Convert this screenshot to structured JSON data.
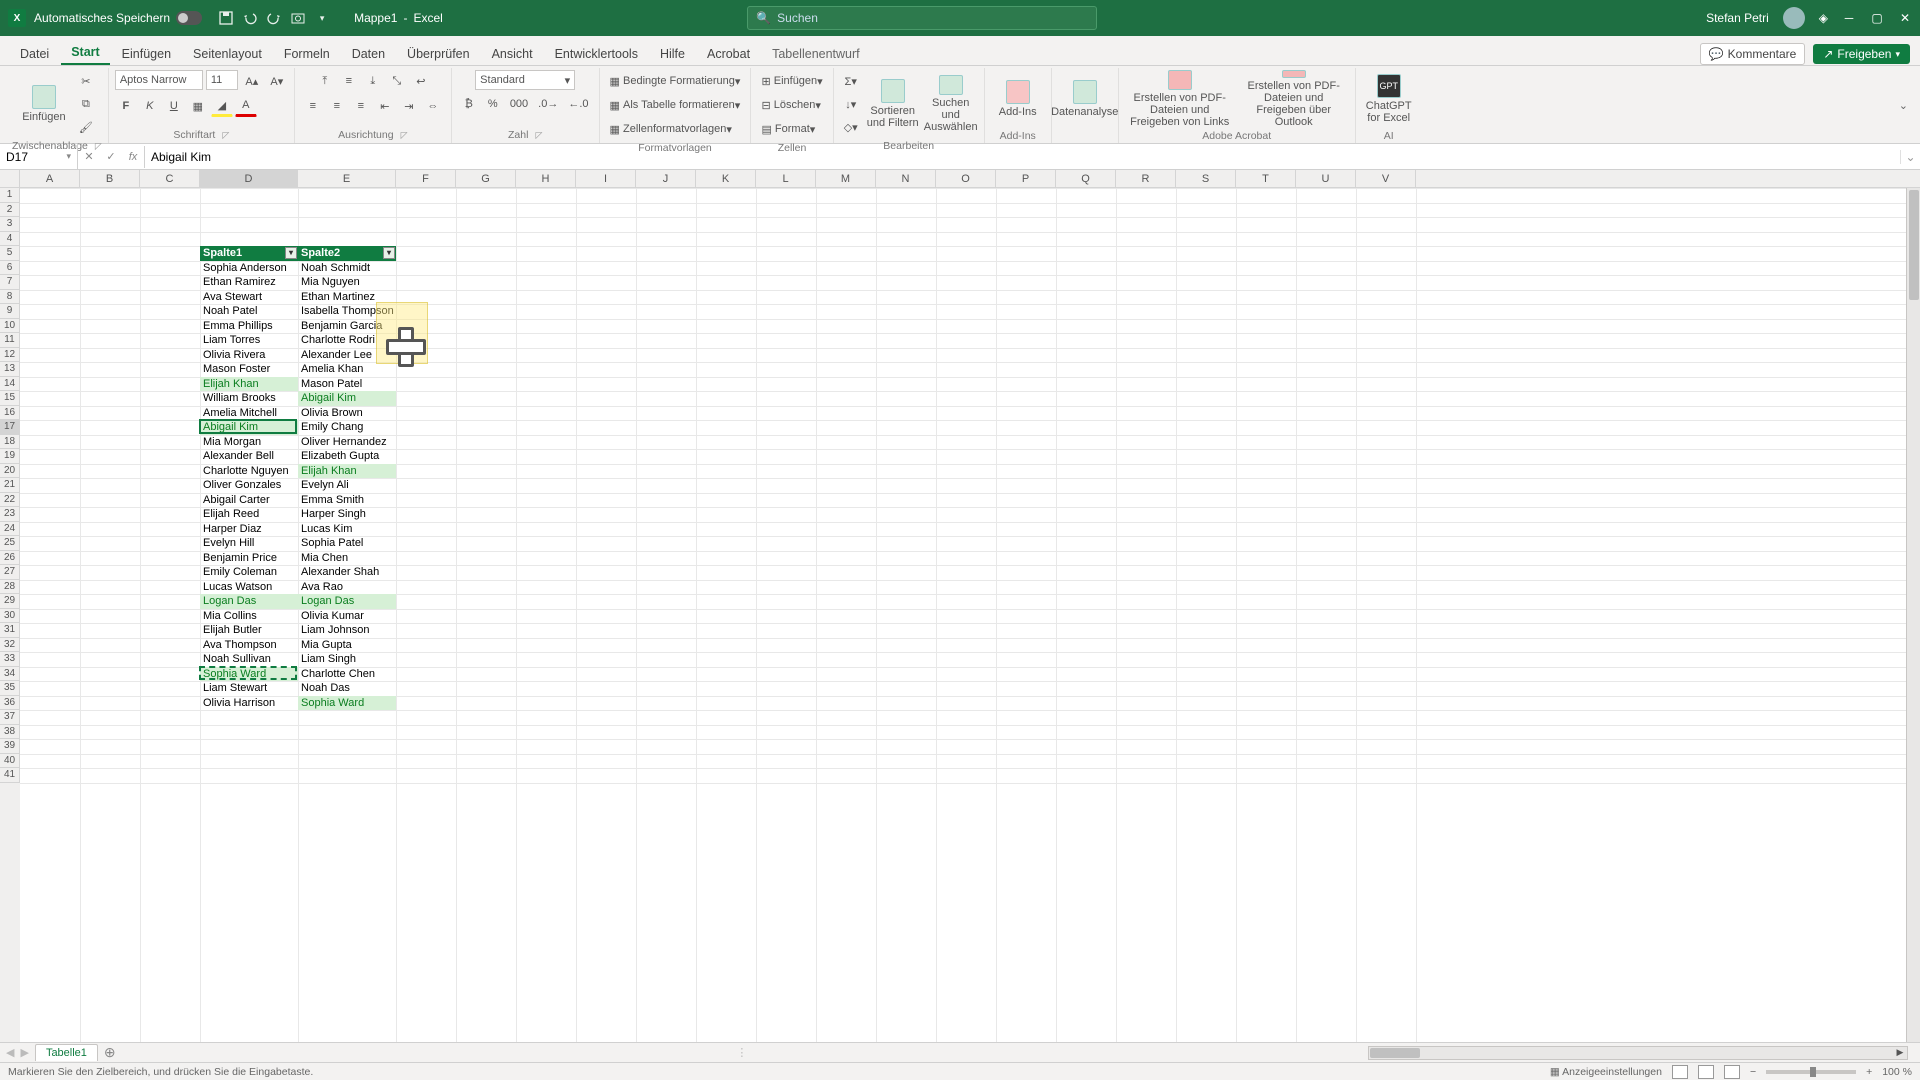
{
  "title": {
    "autosave": "Automatisches Speichern",
    "doc": "Mappe1",
    "app": "Excel",
    "search_placeholder": "Suchen",
    "user": "Stefan Petri"
  },
  "tabs": {
    "file": "Datei",
    "home": "Start",
    "insert": "Einfügen",
    "layout": "Seitenlayout",
    "formulas": "Formeln",
    "data": "Daten",
    "review": "Überprüfen",
    "view": "Ansicht",
    "dev": "Entwicklertools",
    "help": "Hilfe",
    "acrobat": "Acrobat",
    "tabledesign": "Tabellenentwurf",
    "comments": "Kommentare",
    "share": "Freigeben"
  },
  "ribbon": {
    "clipboard": {
      "paste": "Einfügen",
      "label": "Zwischenablage"
    },
    "font": {
      "name": "Aptos Narrow",
      "size": "11",
      "label": "Schriftart"
    },
    "align": {
      "label": "Ausrichtung"
    },
    "number": {
      "format": "Standard",
      "label": "Zahl"
    },
    "styles": {
      "cond": "Bedingte Formatierung",
      "table": "Als Tabelle formatieren",
      "cell": "Zellenformatvorlagen",
      "label": "Formatvorlagen"
    },
    "cells": {
      "insert": "Einfügen",
      "delete": "Löschen",
      "format": "Format",
      "label": "Zellen"
    },
    "editing": {
      "sort": "Sortieren und Filtern",
      "find": "Suchen und Auswählen",
      "label": "Bearbeiten"
    },
    "addins": {
      "btn": "Add-Ins",
      "label": "Add-Ins"
    },
    "analysis": {
      "btn": "Datenanalyse"
    },
    "acrobat": {
      "pdf1": "Erstellen von PDF-Dateien und Freigeben von Links",
      "pdf2": "Erstellen von PDF-Dateien und Freigeben über Outlook",
      "label": "Adobe Acrobat"
    },
    "ai": {
      "btn": "ChatGPT for Excel",
      "label": "AI"
    }
  },
  "fx": {
    "cellref": "D17",
    "formula": "Abigail Kim"
  },
  "table": {
    "headers": [
      "Spalte1",
      "Spalte2"
    ],
    "rows": [
      [
        "Sophia Anderson",
        "Noah Schmidt"
      ],
      [
        "Ethan Ramirez",
        "Mia Nguyen"
      ],
      [
        "Ava Stewart",
        "Ethan Martinez"
      ],
      [
        "Noah Patel",
        "Isabella Thompson"
      ],
      [
        "Emma Phillips",
        "Benjamin Garcia"
      ],
      [
        "Liam Torres",
        "Charlotte Rodri"
      ],
      [
        "Olivia Rivera",
        "Alexander Lee"
      ],
      [
        "Mason Foster",
        "Amelia Khan"
      ],
      [
        "Elijah Khan",
        "Mason Patel"
      ],
      [
        "William Brooks",
        "Abigail Kim"
      ],
      [
        "Amelia Mitchell",
        "Olivia Brown"
      ],
      [
        "Abigail Kim",
        "Emily Chang"
      ],
      [
        "Mia Morgan",
        "Oliver Hernandez"
      ],
      [
        "Alexander Bell",
        "Elizabeth Gupta"
      ],
      [
        "Charlotte Nguyen",
        "Elijah Khan"
      ],
      [
        "Oliver Gonzales",
        "Evelyn Ali"
      ],
      [
        "Abigail Carter",
        "Emma Smith"
      ],
      [
        "Elijah Reed",
        "Harper Singh"
      ],
      [
        "Harper Diaz",
        "Lucas Kim"
      ],
      [
        "Evelyn Hill",
        "Sophia Patel"
      ],
      [
        "Benjamin Price",
        "Mia Chen"
      ],
      [
        "Emily Coleman",
        "Alexander Shah"
      ],
      [
        "Lucas Watson",
        "Ava Rao"
      ],
      [
        "Logan Das",
        "Logan Das"
      ],
      [
        "Mia Collins",
        "Olivia Kumar"
      ],
      [
        "Elijah Butler",
        "Liam Johnson"
      ],
      [
        "Ava Thompson",
        "Mia Gupta"
      ],
      [
        "Noah Sullivan",
        "Liam Singh"
      ],
      [
        "Sophia Ward",
        "Charlotte Chen"
      ],
      [
        "Liam Stewart",
        "Noah Das"
      ],
      [
        "Olivia Harrison",
        "Sophia Ward"
      ]
    ],
    "match_d": [
      8,
      11,
      23,
      28
    ],
    "match_e": [
      9,
      14,
      23,
      30
    ]
  },
  "columns": [
    "A",
    "B",
    "C",
    "D",
    "E",
    "F",
    "G",
    "H",
    "I",
    "J",
    "K",
    "L",
    "M",
    "N",
    "O",
    "P",
    "Q",
    "R",
    "S",
    "T",
    "U",
    "V"
  ],
  "colwidths": {
    "A": 60,
    "B": 60,
    "C": 60,
    "D": 98,
    "E": 98,
    "default": 60
  },
  "sheet": {
    "tab": "Tabelle1"
  },
  "status": {
    "msg": "Markieren Sie den Zielbereich, und drücken Sie die Eingabetaste.",
    "acc": "Anzeigeeinstellungen",
    "zoom": "100 %"
  }
}
